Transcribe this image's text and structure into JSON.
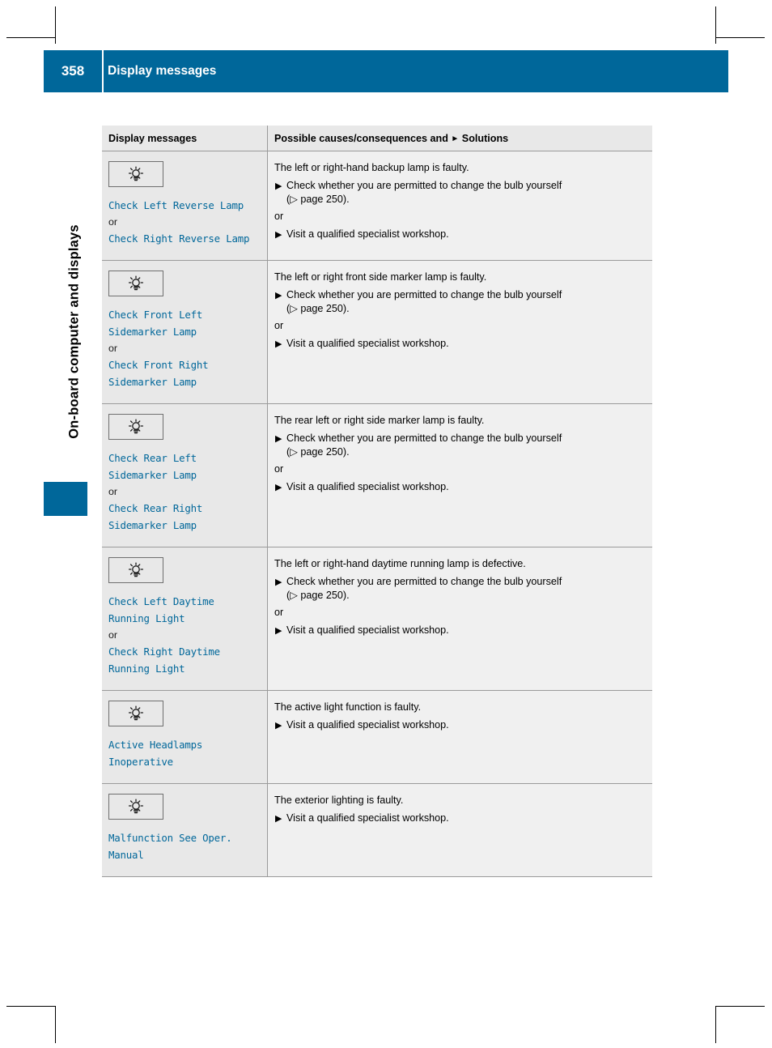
{
  "page": {
    "number": "358",
    "header_title": "Display messages",
    "side_title": "On-board computer and displays"
  },
  "table": {
    "headers": {
      "left": "Display messages",
      "right_pre": "Possible causes/consequences and ",
      "right_post": " Solutions"
    },
    "rows": [
      {
        "icon": "bulb-icon",
        "messages": [
          "Check Left Reverse Lamp",
          "or",
          "Check Right Reverse Lamp"
        ],
        "cause": "The left or right-hand backup lamp is faulty.",
        "solutions": [
          {
            "text": "Check whether you are permitted to change the bulb yourself",
            "cont": "(▷ page 250)."
          }
        ],
        "or": "or",
        "solutions2": [
          {
            "text": "Visit a qualified specialist workshop.",
            "cont": ""
          }
        ]
      },
      {
        "icon": "bulb-icon",
        "messages": [
          "Check Front Left Sidemarker Lamp",
          "or",
          "Check Front Right Sidemarker Lamp"
        ],
        "cause": "The left or right front side marker lamp is faulty.",
        "solutions": [
          {
            "text": "Check whether you are permitted to change the bulb yourself",
            "cont": "(▷ page 250)."
          }
        ],
        "or": "or",
        "solutions2": [
          {
            "text": "Visit a qualified specialist workshop.",
            "cont": ""
          }
        ]
      },
      {
        "icon": "bulb-icon",
        "messages": [
          "Check Rear Left Sidemarker Lamp",
          "or",
          "Check Rear Right Sidemarker Lamp"
        ],
        "cause": "The rear left or right side marker lamp is faulty.",
        "solutions": [
          {
            "text": "Check whether you are permitted to change the bulb yourself",
            "cont": "(▷ page 250)."
          }
        ],
        "or": "or",
        "solutions2": [
          {
            "text": "Visit a qualified specialist workshop.",
            "cont": ""
          }
        ]
      },
      {
        "icon": "bulb-icon",
        "messages": [
          "Check Left Daytime Running Light",
          "or",
          "Check Right Daytime Running Light"
        ],
        "cause": "The left or right-hand daytime running lamp is defective.",
        "solutions": [
          {
            "text": "Check whether you are permitted to change the bulb yourself",
            "cont": "(▷ page 250)."
          }
        ],
        "or": "or",
        "solutions2": [
          {
            "text": "Visit a qualified specialist workshop.",
            "cont": ""
          }
        ]
      },
      {
        "icon": "bulb-icon",
        "messages": [
          "Active Headlamps Inoperative"
        ],
        "cause": "The active light function is faulty.",
        "solutions": [
          {
            "text": "Visit a qualified specialist workshop.",
            "cont": ""
          }
        ],
        "or": "",
        "solutions2": []
      },
      {
        "icon": "bulb-icon",
        "messages": [
          "Malfunction See Oper. Manual"
        ],
        "cause": "The exterior lighting is faulty.",
        "solutions": [
          {
            "text": "Visit a qualified specialist workshop.",
            "cont": ""
          }
        ],
        "or": "",
        "solutions2": []
      }
    ]
  },
  "colors": {
    "accent": "#00679a",
    "message_text": "#00679a",
    "cell_left_bg": "#e8e8e8",
    "cell_right_bg": "#f0f0f0"
  }
}
